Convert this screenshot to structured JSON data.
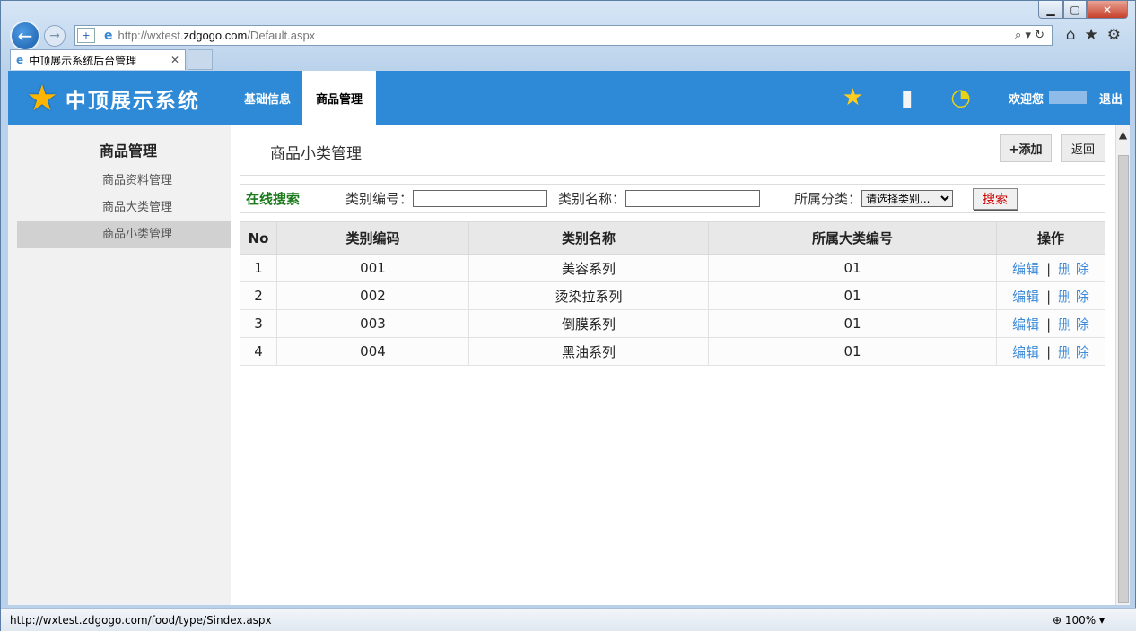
{
  "browser": {
    "url_prefix": "http://wxtest.",
    "url_domain": "zdgogo.com",
    "url_path": "/Default.aspx",
    "tab_title": "中顶展示系统后台管理",
    "status_url": "http://wxtest.zdgogo.com/food/type/Sindex.aspx",
    "zoom": "100%"
  },
  "header": {
    "logo_text": "中顶展示系统",
    "menu": [
      "基础信息",
      "商品管理"
    ],
    "active_menu": "商品管理",
    "welcome": "欢迎您",
    "logout": "退出"
  },
  "sidebar": {
    "title": "商品管理",
    "items": [
      "商品资料管理",
      "商品大类管理",
      "商品小类管理"
    ],
    "active": "商品小类管理"
  },
  "main": {
    "title": "商品小类管理",
    "add_button": "+添加",
    "back_button": "返回"
  },
  "search": {
    "label": "在线搜索",
    "code_label": "类别编号：",
    "name_label": "类别名称：",
    "category_label": "所属分类：",
    "category_selected": "请选择类别...",
    "button": "搜索"
  },
  "table": {
    "headers": [
      "No",
      "类别编码",
      "类别名称",
      "所属大类编号",
      "操作"
    ],
    "edit_label": "编辑",
    "delete_label": "删 除",
    "separator": "|",
    "rows": [
      {
        "no": "1",
        "code": "001",
        "name": "美容系列",
        "parent": "01"
      },
      {
        "no": "2",
        "code": "002",
        "name": "烫染拉系列",
        "parent": "01"
      },
      {
        "no": "3",
        "code": "003",
        "name": "倒膜系列",
        "parent": "01"
      },
      {
        "no": "4",
        "code": "004",
        "name": "黑油系列",
        "parent": "01"
      }
    ]
  },
  "colors": {
    "header_bg": "#2e8ad6",
    "sidebar_bg": "#f1f1f1",
    "link": "#3b8ad8",
    "search_label": "#1b7a1b",
    "search_button_text": "#cc0000"
  }
}
